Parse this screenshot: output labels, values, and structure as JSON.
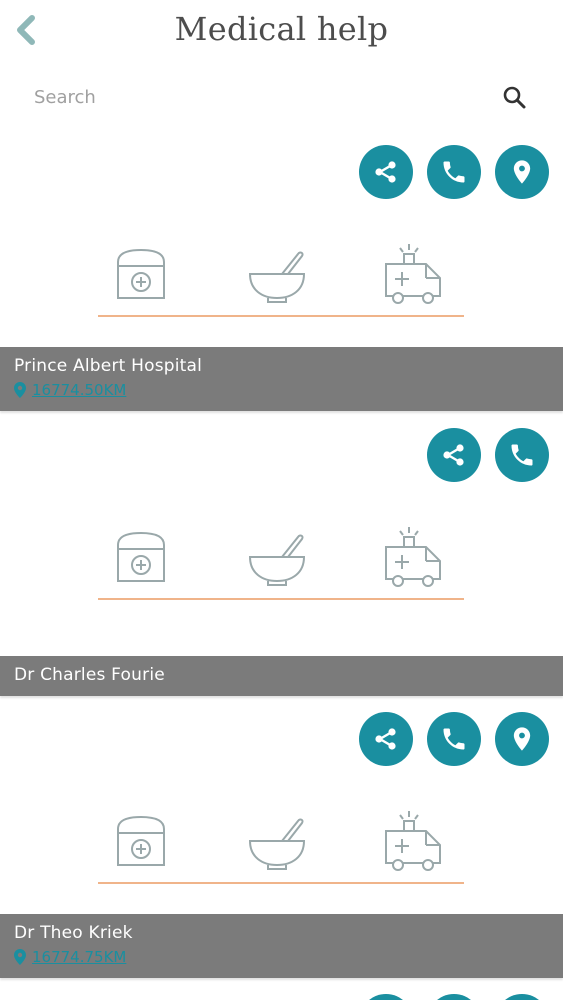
{
  "header": {
    "title": "Medical help",
    "back_icon": "chevron-left-icon"
  },
  "search": {
    "placeholder": "Search",
    "value": "",
    "icon": "search-icon"
  },
  "colors": {
    "accent": "#1a8fa0",
    "band": "#7b7b7b",
    "divider": "#f0b48a",
    "icon_stroke": "#9aa8aa"
  },
  "services": [
    "first-aid-kit-icon",
    "mortar-pestle-icon",
    "ambulance-icon"
  ],
  "cards": [
    {
      "name": "Prince Albert Hospital",
      "distance": "16774.50KM",
      "actions": [
        "share",
        "call",
        "location"
      ]
    },
    {
      "name": "Dr Charles Fourie",
      "distance": "",
      "actions": [
        "share",
        "call"
      ]
    },
    {
      "name": "Dr Theo Kriek",
      "distance": "16774.75KM",
      "actions": [
        "share",
        "call",
        "location"
      ]
    }
  ]
}
